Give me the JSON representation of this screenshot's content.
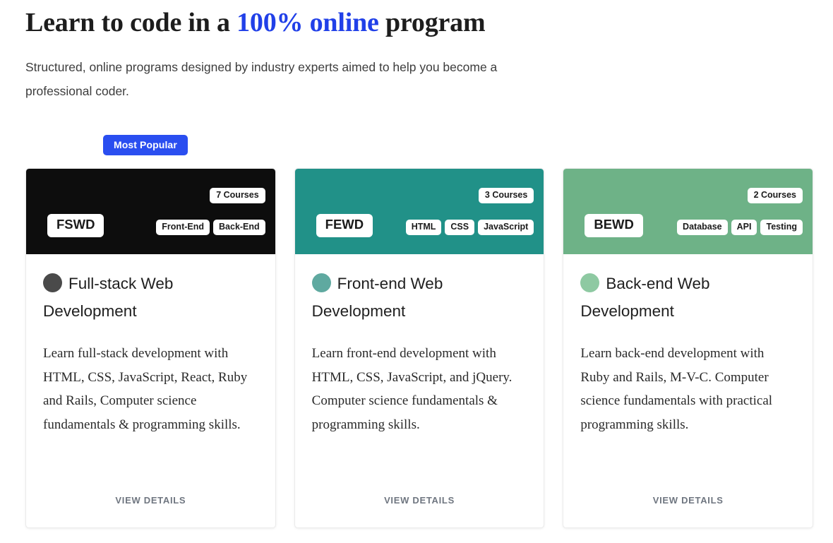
{
  "hero": {
    "title_part1": "Learn to code in a ",
    "title_accent": "100% online",
    "title_part2": " program",
    "subtitle": "Structured, online programs designed by industry experts aimed to help you become a professional coder."
  },
  "badge": {
    "label": "Most Popular"
  },
  "colors": {
    "accent_blue": "#2140e8",
    "badge_blue": "#2a4ef0",
    "card1_header": "#0d0d0d",
    "card2_header": "#219188",
    "card3_header": "#6eb287",
    "card1_dot": "#4a4a4a",
    "card2_dot": "#5fa9a0",
    "card3_dot": "#8ec9a2",
    "view_details": "#6f7680"
  },
  "cards": [
    {
      "code": "FSWD",
      "courses": "7 Courses",
      "tags": [
        "Front-End",
        "Back-End"
      ],
      "title": "Full-stack Web Development",
      "description": "Learn full-stack development with HTML, CSS, JavaScript, React, Ruby and Rails, Computer science fundamentals & programming skills.",
      "cta": "View Details",
      "header_color": "#0d0d0d",
      "dot_color": "#4a4a4a"
    },
    {
      "code": "FEWD",
      "courses": "3 Courses",
      "tags": [
        "HTML",
        "CSS",
        "JavaScript"
      ],
      "title": "Front-end Web Development",
      "description": "Learn front-end development with HTML, CSS, JavaScript, and jQuery. Computer science fundamentals & programming skills.",
      "cta": "View Details",
      "header_color": "#219188",
      "dot_color": "#5fa9a0"
    },
    {
      "code": "BEWD",
      "courses": "2 Courses",
      "tags": [
        "Database",
        "API",
        "Testing"
      ],
      "title": "Back-end Web Development",
      "description": "Learn back-end development with Ruby and Rails, M-V-C. Computer science fundamentals with practical programming skills.",
      "cta": "View Details",
      "header_color": "#6eb287",
      "dot_color": "#8ec9a2"
    }
  ]
}
